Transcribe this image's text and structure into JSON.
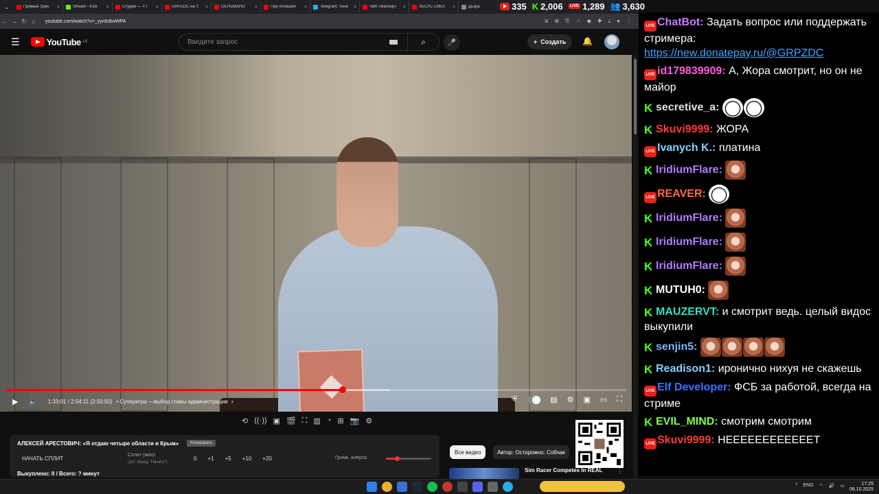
{
  "browser": {
    "tabs": [
      {
        "label": "Прямые тран",
        "color": "#ff0000"
      },
      {
        "label": "Stream - Kick",
        "color": "#53fc18"
      },
      {
        "label": "Студия — YT",
        "color": "#ff0000"
      },
      {
        "label": "GRPZDC на Y",
        "color": "#ff0000"
      },
      {
        "label": "ОСНОВАНО",
        "color": "#ff0000"
      },
      {
        "label": "Про отношен",
        "color": "#ff0000"
      },
      {
        "label": "Telegram: View",
        "color": "#2aabee"
      },
      {
        "label": "ЧВК «Вагнер»",
        "color": "#ff0000"
      },
      {
        "label": "ХЕСУС СМОТ",
        "color": "#ff0000"
      },
      {
        "label": "Дьзра",
        "color": "#888888"
      }
    ],
    "url": "youtube.com/watch?v=_yyrdsBwWPA"
  },
  "stats": {
    "youtube_viewers": "335",
    "kick_viewers": "2,006",
    "live_viewers": "1,289",
    "total_viewers": "3,630"
  },
  "youtube": {
    "logo_text": "YouTube",
    "country": "LV",
    "search_placeholder": "Введите запрос",
    "create_label": "Создать",
    "player": {
      "current_time": "1:33:01",
      "duration": "2:54:11",
      "remaining": "(2:50:50)",
      "time_display": "1:33:01 / 2:54:11 (2:50:50)",
      "chapter": "• Суперигра —выбор главы администрации",
      "progress": 0.543,
      "buffered": 0.62
    },
    "recommendation": {
      "chip_all": "Все видео",
      "chip_author": "Автор: Осторожно: Собчак",
      "title": "Sim Racer Competes In REAL"
    }
  },
  "split_panel": {
    "title": "АЛЕКСЕЙ АРЕСТОВИЧ: «Я отдаю четыре области и Крым»",
    "copy_label": "Копировать",
    "start_label": "НАЧАТЬ СПЛИТ",
    "split_label": "Сплит (мин):",
    "split_hint": "(уст. перед \"Начать\")",
    "split_value": "0",
    "buttons": [
      "+1",
      "+5",
      "+10",
      "+20"
    ],
    "volume_label": "Громк. алерта:",
    "volume": 0.24,
    "bought": "Выкуплено: 0 / Всего: ? минут"
  },
  "chat": {
    "messages": [
      {
        "platform": "yt",
        "user": "ChatBot",
        "color": "#c77dff",
        "text": "Задать вопрос или поддержать стримера:",
        "link": "https://new.donatepay.ru/@GRPZDC",
        "emotes": 0
      },
      {
        "platform": "yt",
        "user": "id179839909",
        "color": "#ff5ce1",
        "text": "А, Жора смотрит, но он не майор",
        "emotes": 0
      },
      {
        "platform": "k",
        "user": "secretive_a",
        "color": "#e0e0e0",
        "text": "",
        "emotes": 2,
        "emote_kind": "face"
      },
      {
        "platform": "k",
        "user": "Skuvi9999",
        "color": "#ff3b3b",
        "text": "ЖОРА",
        "emotes": 0
      },
      {
        "platform": "yt",
        "user": "Ivanych K.",
        "color": "#7fd3ff",
        "text": "платина",
        "emotes": 0
      },
      {
        "platform": "k",
        "user": "IridiumFlare",
        "color": "#b07cff",
        "text": "",
        "emotes": 1,
        "emote_kind": "meme"
      },
      {
        "platform": "yt",
        "user": "REAVER",
        "color": "#ff6a3a",
        "text": "",
        "emotes": 1,
        "emote_kind": "face"
      },
      {
        "platform": "k",
        "user": "IridiumFlare",
        "color": "#b07cff",
        "text": "",
        "emotes": 1,
        "emote_kind": "meme"
      },
      {
        "platform": "k",
        "user": "IridiumFlare",
        "color": "#b07cff",
        "text": "",
        "emotes": 1,
        "emote_kind": "meme"
      },
      {
        "platform": "k",
        "user": "IridiumFlare",
        "color": "#b07cff",
        "text": "",
        "emotes": 1,
        "emote_kind": "meme"
      },
      {
        "platform": "k",
        "user": "MUTUH0",
        "color": "#ffffff",
        "text": "",
        "emotes": 1,
        "emote_kind": "meme"
      },
      {
        "platform": "k",
        "user": "MAUZERVT",
        "color": "#34e0c0",
        "text": "и смотрит ведь. целый видос выкупили",
        "emotes": 0
      },
      {
        "platform": "k",
        "user": "senjin5",
        "color": "#7fb3ff",
        "text": "",
        "emotes": 4,
        "emote_kind": "meme"
      },
      {
        "platform": "k",
        "user": "Readison1",
        "color": "#7fd3ff",
        "text": "иронично нихуя не скажешь",
        "emotes": 0
      },
      {
        "platform": "yt",
        "user": "Elf Developer",
        "color": "#3a73ff",
        "text": "ФСБ за работой, всегда на стриме",
        "emotes": 0
      },
      {
        "platform": "k",
        "user": "EVIL_MIND",
        "color": "#7dff4a",
        "text": "смотрим смотрим",
        "emotes": 0
      },
      {
        "platform": "yt",
        "user": "Skuvi9999",
        "color": "#ff3b3b",
        "text": "НЕЕЕЕЕЕЕЕЕЕЕЕТ",
        "emotes": 0
      }
    ]
  },
  "taskbar": {
    "lang": "ENG",
    "time": "17:25",
    "date": "06.10.2025"
  }
}
